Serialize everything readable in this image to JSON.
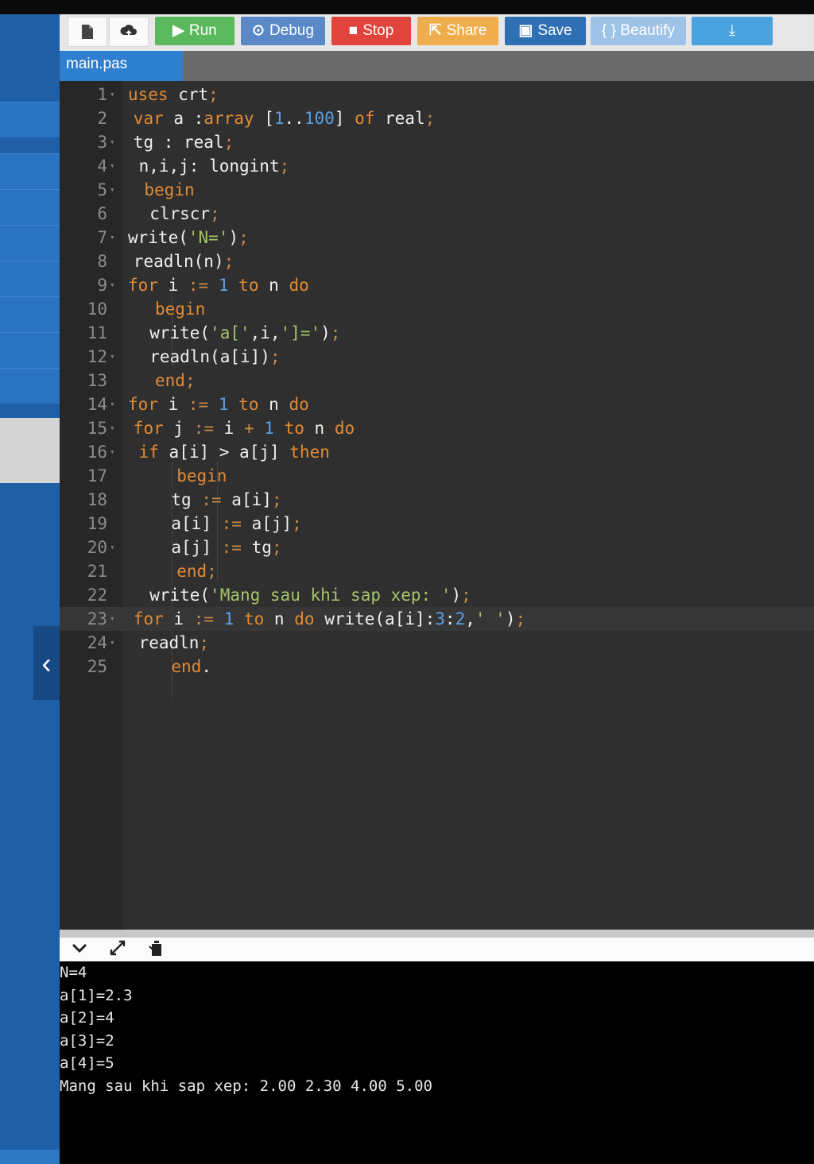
{
  "toolbar": {
    "buttons": [
      {
        "name": "new-file",
        "icon": "file-icon",
        "label": ""
      },
      {
        "name": "upload",
        "icon": "upload-icon",
        "label": ""
      },
      {
        "name": "run",
        "icon": "play-icon",
        "label": "Run",
        "color": "#5cb85c"
      },
      {
        "name": "debug",
        "icon": "debug-icon",
        "label": "Debug",
        "color": "#5b88c6"
      },
      {
        "name": "stop",
        "icon": "stop-icon",
        "label": "Stop",
        "color": "#e0443d"
      },
      {
        "name": "share",
        "icon": "share-icon",
        "label": "Share",
        "color": "#f0ad4e"
      },
      {
        "name": "save",
        "icon": "save-icon",
        "label": "Save",
        "color": "#2f6fb3"
      },
      {
        "name": "beautify",
        "icon": "braces-icon",
        "label": "{ } Beautify",
        "color": "#9ec3e8"
      },
      {
        "name": "download",
        "icon": "download-icon",
        "label": "",
        "color": "#4aa3df"
      }
    ]
  },
  "tab": {
    "label": "main.pas"
  },
  "editor": {
    "current_line": 23,
    "lines": [
      {
        "n": "1",
        "fold": true
      },
      {
        "n": "2",
        "fold": false
      },
      {
        "n": "3",
        "fold": true
      },
      {
        "n": "4",
        "fold": true
      },
      {
        "n": "5",
        "fold": true
      },
      {
        "n": "6",
        "fold": false
      },
      {
        "n": "7",
        "fold": true
      },
      {
        "n": "8",
        "fold": false
      },
      {
        "n": "9",
        "fold": true
      },
      {
        "n": "10",
        "fold": false
      },
      {
        "n": "11",
        "fold": false
      },
      {
        "n": "12",
        "fold": true
      },
      {
        "n": "13",
        "fold": false
      },
      {
        "n": "14",
        "fold": true
      },
      {
        "n": "15",
        "fold": true
      },
      {
        "n": "16",
        "fold": true
      },
      {
        "n": "17",
        "fold": false
      },
      {
        "n": "18",
        "fold": false
      },
      {
        "n": "19",
        "fold": false
      },
      {
        "n": "20",
        "fold": true
      },
      {
        "n": "21",
        "fold": false
      },
      {
        "n": "22",
        "fold": false
      },
      {
        "n": "23",
        "fold": true
      },
      {
        "n": "24",
        "fold": true
      },
      {
        "n": "25",
        "fold": false
      }
    ],
    "tokens": [
      [
        [
          "kw",
          "uses"
        ],
        [
          "",
          "crt"
        ],
        [
          "op",
          ";"
        ]
      ],
      [
        [
          "kw",
          "var"
        ],
        [
          "",
          "a :"
        ],
        [
          "kw",
          "array"
        ],
        [
          "",
          "["
        ],
        [
          "num",
          "1"
        ],
        [
          "",
          ".."
        ],
        [
          "num",
          "100"
        ],
        [
          "",
          "]"
        ],
        [
          "kw",
          "of"
        ],
        [
          "",
          "real"
        ],
        [
          "op",
          ";"
        ]
      ],
      [
        [
          "",
          "tg : real"
        ],
        [
          "op",
          ";"
        ]
      ],
      [
        [
          "",
          "n,i,j: longint"
        ],
        [
          "op",
          ";"
        ]
      ],
      [
        [
          "kw",
          "begin"
        ]
      ],
      [
        [
          "",
          "clrscr"
        ],
        [
          "op",
          ";"
        ]
      ],
      [
        [
          "",
          "write("
        ],
        [
          "str",
          "'N='"
        ],
        [
          "",
          ")"
        ],
        [
          "op",
          ";"
        ]
      ],
      [
        [
          "",
          "readln(n)"
        ],
        [
          "op",
          ";"
        ]
      ],
      [
        [
          "kw",
          "for"
        ],
        [
          "",
          "i"
        ],
        [
          "op",
          ":="
        ],
        [
          "num",
          "1"
        ],
        [
          "kw",
          "to"
        ],
        [
          "",
          "n"
        ],
        [
          "kw",
          "do"
        ]
      ],
      [
        [
          "kw",
          "begin"
        ]
      ],
      [
        [
          "",
          "write("
        ],
        [
          "str",
          "'a['"
        ],
        [
          "",
          ",i,"
        ],
        [
          "str",
          "']='"
        ],
        [
          "",
          ")"
        ],
        [
          "op",
          ";"
        ]
      ],
      [
        [
          "",
          "readln(a[i])"
        ],
        [
          "op",
          ";"
        ]
      ],
      [
        [
          "kw",
          "end"
        ],
        [
          "op",
          ";"
        ]
      ],
      [
        [
          "kw",
          "for"
        ],
        [
          "",
          "i"
        ],
        [
          "op",
          ":="
        ],
        [
          "num",
          "1"
        ],
        [
          "kw",
          "to"
        ],
        [
          "",
          "n"
        ],
        [
          "kw",
          "do"
        ]
      ],
      [
        [
          "kw",
          "for"
        ],
        [
          "",
          "j"
        ],
        [
          "op",
          ":="
        ],
        [
          "",
          "i"
        ],
        [
          "op",
          "+"
        ],
        [
          "num",
          "1"
        ],
        [
          "kw",
          "to"
        ],
        [
          "",
          "n"
        ],
        [
          "kw",
          "do"
        ]
      ],
      [
        [
          "kw",
          "if"
        ],
        [
          "",
          "a[i] > a[j]"
        ],
        [
          "kw",
          "then"
        ]
      ],
      [
        [
          "kw",
          "begin"
        ]
      ],
      [
        [
          "",
          "tg"
        ],
        [
          "op",
          ":="
        ],
        [
          "",
          "a[i]"
        ],
        [
          "op",
          ";"
        ]
      ],
      [
        [
          "",
          "a[i]"
        ],
        [
          "op",
          ":="
        ],
        [
          "",
          "a[j]"
        ],
        [
          "op",
          ";"
        ]
      ],
      [
        [
          "",
          "a[j]"
        ],
        [
          "op",
          ":="
        ],
        [
          "",
          "tg"
        ],
        [
          "op",
          ";"
        ]
      ],
      [
        [
          "kw",
          "end"
        ],
        [
          "op",
          ";"
        ]
      ],
      [
        [
          "",
          "write("
        ],
        [
          "str",
          "'Mang sau khi sap xep: '"
        ],
        [
          "",
          ")"
        ],
        [
          "op",
          ";"
        ]
      ],
      [
        [
          "kw",
          "for"
        ],
        [
          "",
          "i"
        ],
        [
          "op",
          ":="
        ],
        [
          "num",
          "1"
        ],
        [
          "kw",
          "to"
        ],
        [
          "",
          "n"
        ],
        [
          "kw",
          "do"
        ],
        [
          "",
          "write(a[i]:"
        ],
        [
          "num",
          "3"
        ],
        [
          "",
          ":"
        ],
        [
          "num",
          "2"
        ],
        [
          "",
          ","
        ],
        [
          "str",
          "' '"
        ],
        [
          "",
          ")"
        ],
        [
          "op",
          ";"
        ]
      ],
      [
        [
          "",
          "readln"
        ],
        [
          "op",
          ";"
        ]
      ],
      [
        [
          "kw",
          "end"
        ],
        [
          "",
          "."
        ]
      ]
    ]
  },
  "output_toolbar": {
    "icons": [
      "chevron-down-icon",
      "expand-icon",
      "clear-icon"
    ]
  },
  "output": {
    "lines": [
      "N=4",
      "a[1]=2.3",
      "a[2]=4",
      "a[3]=2",
      "a[4]=5",
      "Mang sau khi sap xep: 2.00 2.30 4.00 5.00"
    ]
  }
}
